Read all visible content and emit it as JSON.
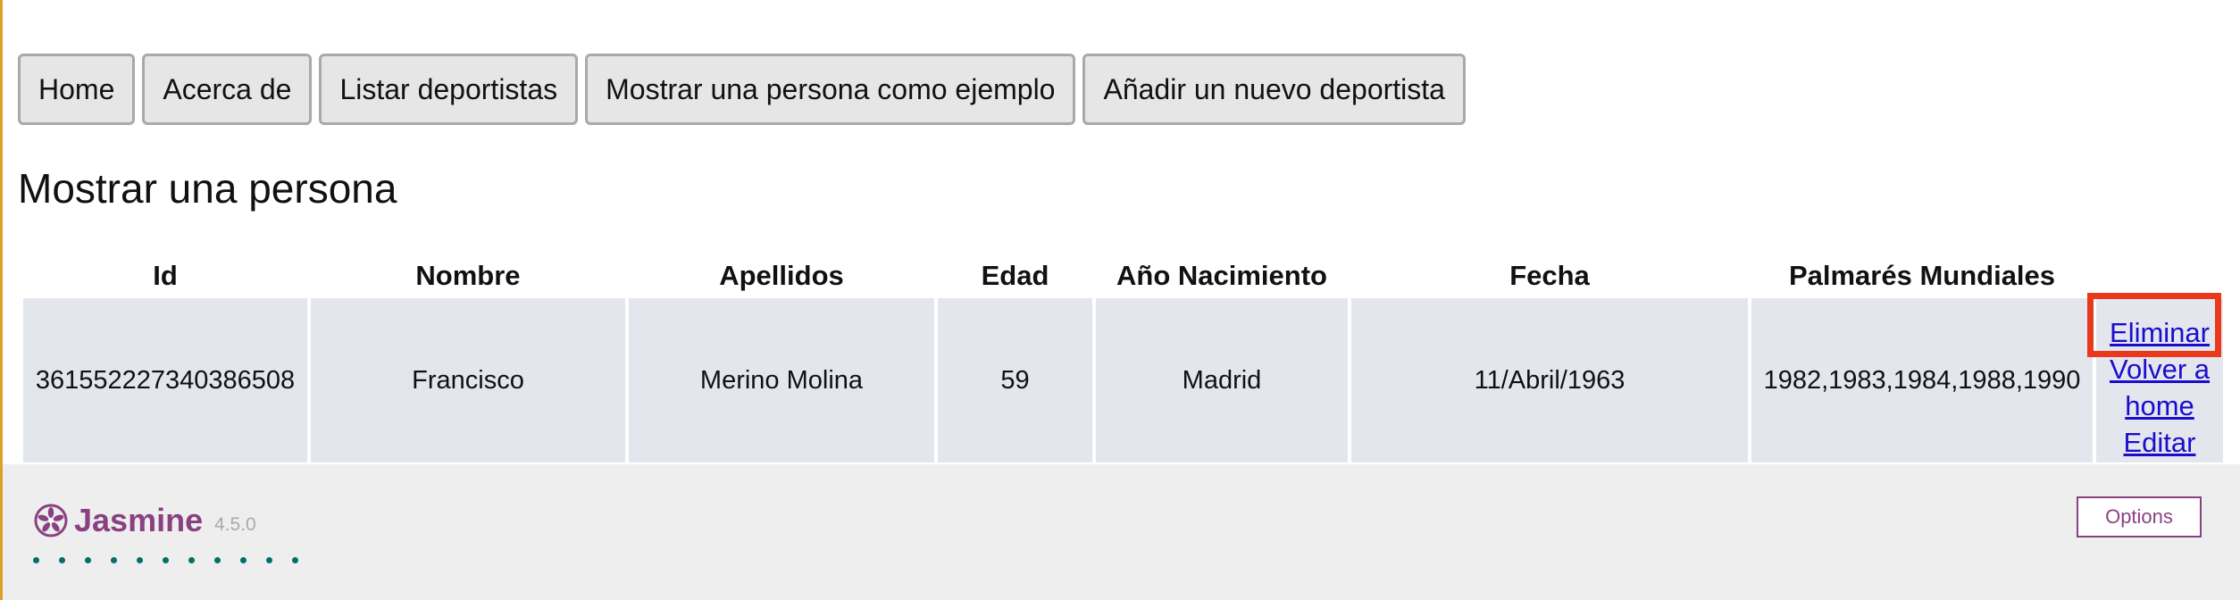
{
  "nav": {
    "buttons": [
      {
        "label": "Home"
      },
      {
        "label": "Acerca de"
      },
      {
        "label": "Listar deportistas"
      },
      {
        "label": "Mostrar una persona como ejemplo"
      },
      {
        "label": "Añadir un nuevo deportista"
      }
    ]
  },
  "main": {
    "section_title": "Mostrar una persona",
    "table": {
      "headers": [
        "Id",
        "Nombre",
        "Apellidos",
        "Edad",
        "Año Nacimiento",
        "Fecha",
        "Palmarés Mundiales"
      ],
      "row": {
        "id": "361552227340386508",
        "nombre": "Francisco",
        "apellidos": "Merino Molina",
        "edad": "59",
        "nacimiento": "Madrid",
        "fecha": "11/Abril/1963",
        "palmares": "1982,1983,1984,1988,1990"
      },
      "actions": {
        "delete": "Eliminar",
        "back_line1": "Volver a",
        "back_line2": "home",
        "edit": "Editar"
      }
    }
  },
  "jasmine": {
    "logo_text": "Jasmine",
    "version": "4.5.0",
    "options_label": "Options",
    "dot_count": 11,
    "brand_color": "#8a4182",
    "dot_color": "#007069"
  },
  "colors": {
    "highlight": "#e8391d",
    "link": "#1a0dcc",
    "left_border": "#e0a028"
  }
}
